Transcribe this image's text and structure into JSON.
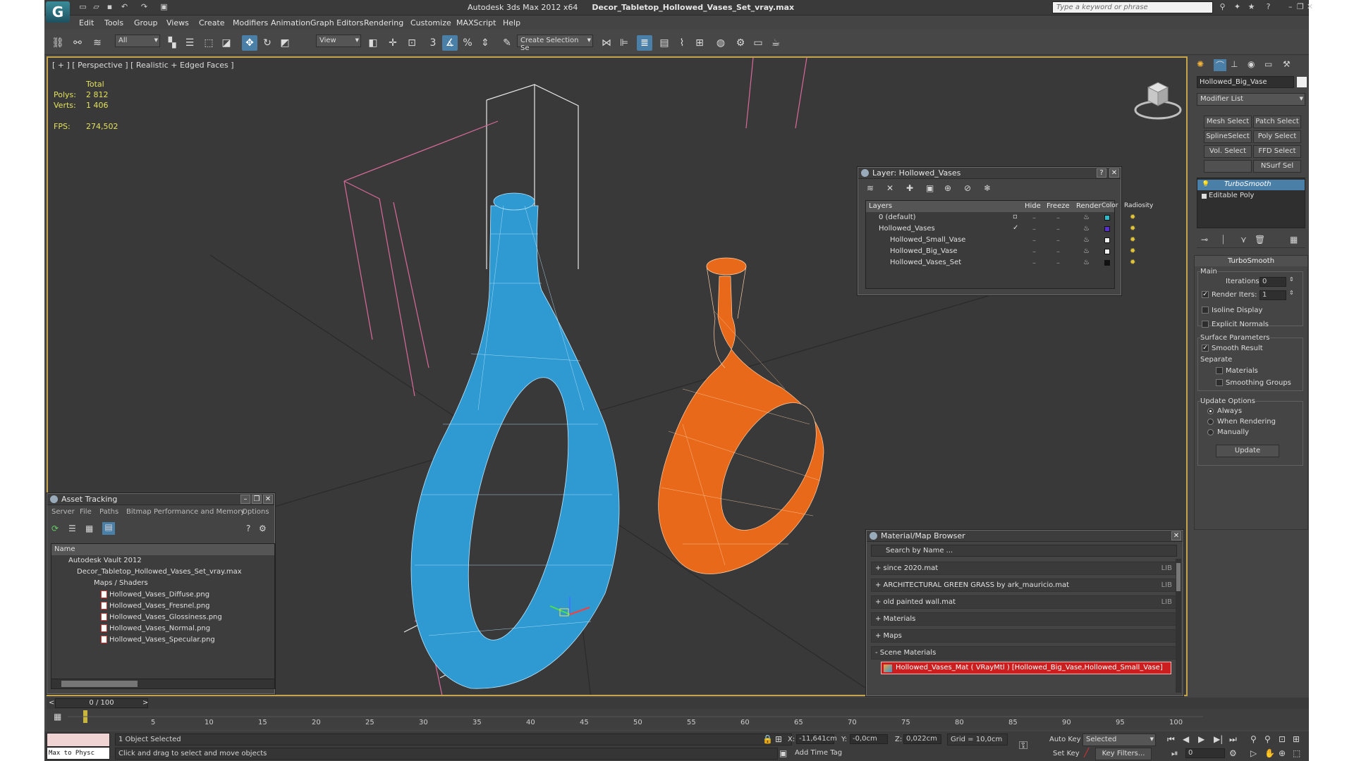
{
  "window": {
    "app_name": "Autodesk 3ds Max  2012 x64",
    "file_name": "Decor_Tabletop_Hollowed_Vases_Set_vray.max",
    "search_placeholder": "Type a keyword or phrase"
  },
  "menu": [
    "Edit",
    "Tools",
    "Group",
    "Views",
    "Create",
    "Modifiers",
    "Animation",
    "Graph Editors",
    "Rendering",
    "Customize",
    "MAXScript",
    "Help"
  ],
  "toolbar": {
    "selection_filter": "All",
    "ref_coord": "View",
    "named_selection": "Create Selection Se",
    "snap_label": "3"
  },
  "viewport": {
    "label": "[ + ] [ Perspective ] [ Realistic + Edged Faces ]",
    "stats": {
      "total_label": "Total",
      "polys_label": "Polys:",
      "polys_value": "2 812",
      "verts_label": "Verts:",
      "verts_value": "1 406",
      "fps_label": "FPS:",
      "fps_value": "274,502"
    },
    "colors": {
      "blue_vase": "#2f9ad2",
      "orange_vase": "#e8691a",
      "background": "#393939",
      "border": "#c6a44a"
    }
  },
  "layer_panel": {
    "title": "Layer: Hollowed_Vases",
    "columns": [
      "Layers",
      "Hide",
      "Freeze",
      "Render",
      "Color",
      "Radiosity"
    ],
    "rows": [
      {
        "name": "0 (default)",
        "color": "#2fb8c8"
      },
      {
        "name": "Hollowed_Vases",
        "color": "#5a2fd0"
      },
      {
        "name": "Hollowed_Small_Vase",
        "color": "#f0f0f0"
      },
      {
        "name": "Hollowed_Big_Vase",
        "color": "#f0f0f0"
      },
      {
        "name": "Hollowed_Vases_Set",
        "color": "#111111"
      }
    ]
  },
  "asset_panel": {
    "title": "Asset Tracking",
    "menu": [
      "Server",
      "File",
      "Paths",
      "Bitmap Performance and Memory",
      "Options"
    ],
    "column": "Name",
    "items": [
      "Autodesk Vault 2012",
      "Decor_Tabletop_Hollowed_Vases_Set_vray.max",
      "Maps / Shaders",
      "Hollowed_Vases_Diffuse.png",
      "Hollowed_Vases_Fresnel.png",
      "Hollowed_Vases_Glossiness.png",
      "Hollowed_Vases_Normal.png",
      "Hollowed_Vases_Specular.png"
    ]
  },
  "material_browser": {
    "title": "Material/Map Browser",
    "search_placeholder": "Search by Name ...",
    "lib_tag": "LIB",
    "rows": [
      {
        "label": "+ since 2020.mat",
        "lib": true
      },
      {
        "label": "+ ARCHITECTURAL GREEN GRASS by ark_mauricio.mat",
        "lib": true
      },
      {
        "label": "+ old painted wall.mat",
        "lib": true
      },
      {
        "label": "+ Materials",
        "lib": false
      },
      {
        "label": "+ Maps",
        "lib": false
      },
      {
        "label": "- Scene Materials",
        "lib": false
      }
    ],
    "scene_material": "Hollowed_Vases_Mat ( VRayMtl ) [Hollowed_Big_Vase,Hollowed_Small_Vase]"
  },
  "command_panel": {
    "object_name": "Hollowed_Big_Vase",
    "modifier_list": "Modifier List",
    "buttons": [
      "Mesh Select",
      "Patch Select",
      "SplineSelect",
      "Poly Select",
      "Vol. Select",
      "FFD Select",
      "",
      "NSurf Sel"
    ],
    "stack": [
      "TurboSmooth",
      "Editable Poly"
    ],
    "rollout_title": "TurboSmooth",
    "main_label": "Main",
    "iterations_label": "Iterations:",
    "iterations_value": "0",
    "render_iters_label": "Render Iters:",
    "render_iters_value": "1",
    "isoline": "Isoline Display",
    "explicit": "Explicit Normals",
    "surface_params": "Surface Parameters",
    "smooth_result": "Smooth Result",
    "separate": "Separate",
    "materials": "Materials",
    "smoothing_groups": "Smoothing Groups",
    "update_options": "Update Options",
    "always": "Always",
    "when_rendering": "When Rendering",
    "manually": "Manually",
    "update_button": "Update"
  },
  "timeline": {
    "frame_display": "0 / 100",
    "ticks": [
      "5",
      "10",
      "15",
      "20",
      "25",
      "30",
      "35",
      "40",
      "45",
      "50",
      "55",
      "60",
      "65",
      "70",
      "75",
      "80",
      "85",
      "90",
      "95",
      "100"
    ]
  },
  "status": {
    "maxscript": "Max to Physc",
    "selected": "1 Object Selected",
    "prompt": "Click and drag to select and move objects",
    "x_label": "X:",
    "x_value": "-11,641cm",
    "y_label": "Y:",
    "y_value": "-0,0cm",
    "z_label": "Z:",
    "z_value": "0,022cm",
    "grid": "Grid = 10,0cm",
    "add_time_tag": "Add Time Tag",
    "auto_key": "Auto Key",
    "set_key": "Set Key",
    "selected_dd": "Selected",
    "key_filters": "Key Filters...",
    "frame": "0"
  }
}
